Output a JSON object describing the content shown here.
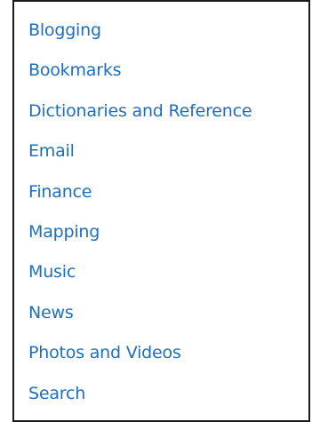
{
  "categories": {
    "items": [
      "Blogging",
      "Bookmarks",
      "Dictionaries and Reference",
      "Email",
      "Finance",
      "Mapping",
      "Music",
      "News",
      "Photos and Videos",
      "Search"
    ]
  },
  "colors": {
    "link": "#1e6fbb",
    "border": "#1a1a1a",
    "background": "#ffffff"
  }
}
